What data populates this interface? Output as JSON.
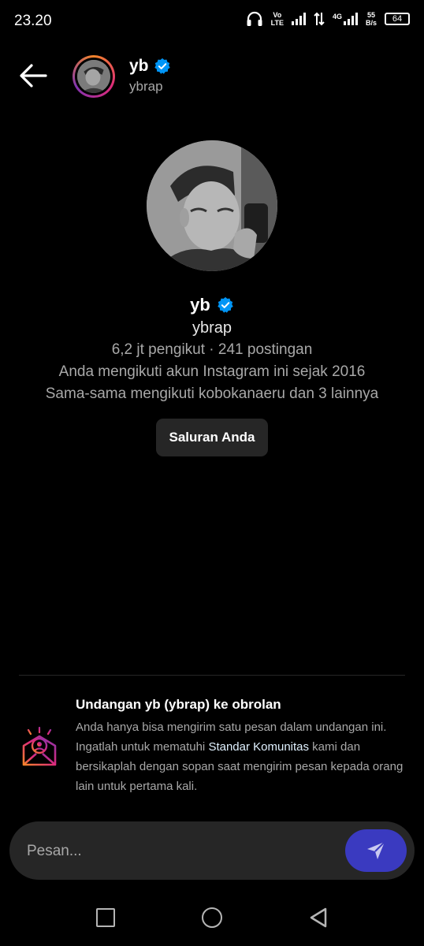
{
  "status_bar": {
    "time": "23.20",
    "volte_top": "Vo",
    "volte_bottom": "LTE",
    "network": "4G",
    "speed_value": "55",
    "speed_unit": "B/s",
    "battery": "64"
  },
  "header": {
    "name": "yb",
    "username": "ybrap"
  },
  "profile": {
    "name": "yb",
    "username": "ybrap",
    "stats": "6,2 jt pengikut · 241 postingan",
    "following_since": "Anda mengikuti akun Instagram ini sejak 2016",
    "mutual": "Sama-sama mengikuti kobokanaeru dan 3 lainnya",
    "channel_button": "Saluran Anda"
  },
  "invite": {
    "title": "Undangan yb (ybrap) ke obrolan",
    "body_before": "Anda hanya bisa mengirim satu pesan dalam undangan ini. Ingatlah untuk mematuhi ",
    "link": "Standar Komunitas",
    "body_after": " kami dan bersikaplah dengan sopan saat mengirim pesan kepada orang lain untuk pertama kali."
  },
  "composer": {
    "placeholder": "Pesan..."
  },
  "colors": {
    "background": "#000000",
    "verified_badge": "#0095f6",
    "send_button": "#3a3ac0",
    "link": "#e0f1ff"
  },
  "icons": [
    "back-arrow-icon",
    "verified-badge-icon",
    "invite-envelope-icon",
    "send-icon",
    "nav-recents-icon",
    "nav-home-icon",
    "nav-back-icon"
  ]
}
